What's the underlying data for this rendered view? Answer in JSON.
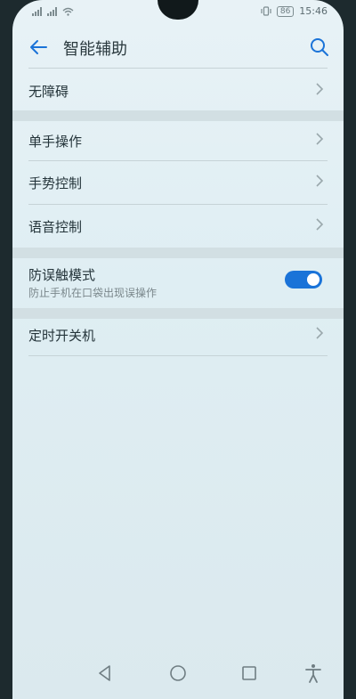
{
  "status_bar": {
    "time": "15:46",
    "battery": "86",
    "icons": [
      "signal-icon",
      "signal-icon",
      "wifi-icon",
      "vibrate-icon",
      "battery-icon"
    ]
  },
  "header": {
    "title": "智能辅助",
    "back_icon": "back-arrow-icon",
    "search_icon": "search-icon"
  },
  "items": [
    {
      "label": "无障碍"
    },
    {
      "label": "单手操作"
    },
    {
      "label": "手势控制"
    },
    {
      "label": "语音控制"
    },
    {
      "label": "防误触模式",
      "sublabel": "防止手机在口袋出现误操作",
      "toggle_on": true
    },
    {
      "label": "定时开关机"
    }
  ],
  "nav_bar": {
    "icons": [
      "back-triangle-icon",
      "home-circle-icon",
      "recents-square-icon",
      "accessibility-icon"
    ]
  },
  "colors": {
    "accent": "#1a73d8",
    "background": "#e3f0f4",
    "text": "#24343a"
  }
}
